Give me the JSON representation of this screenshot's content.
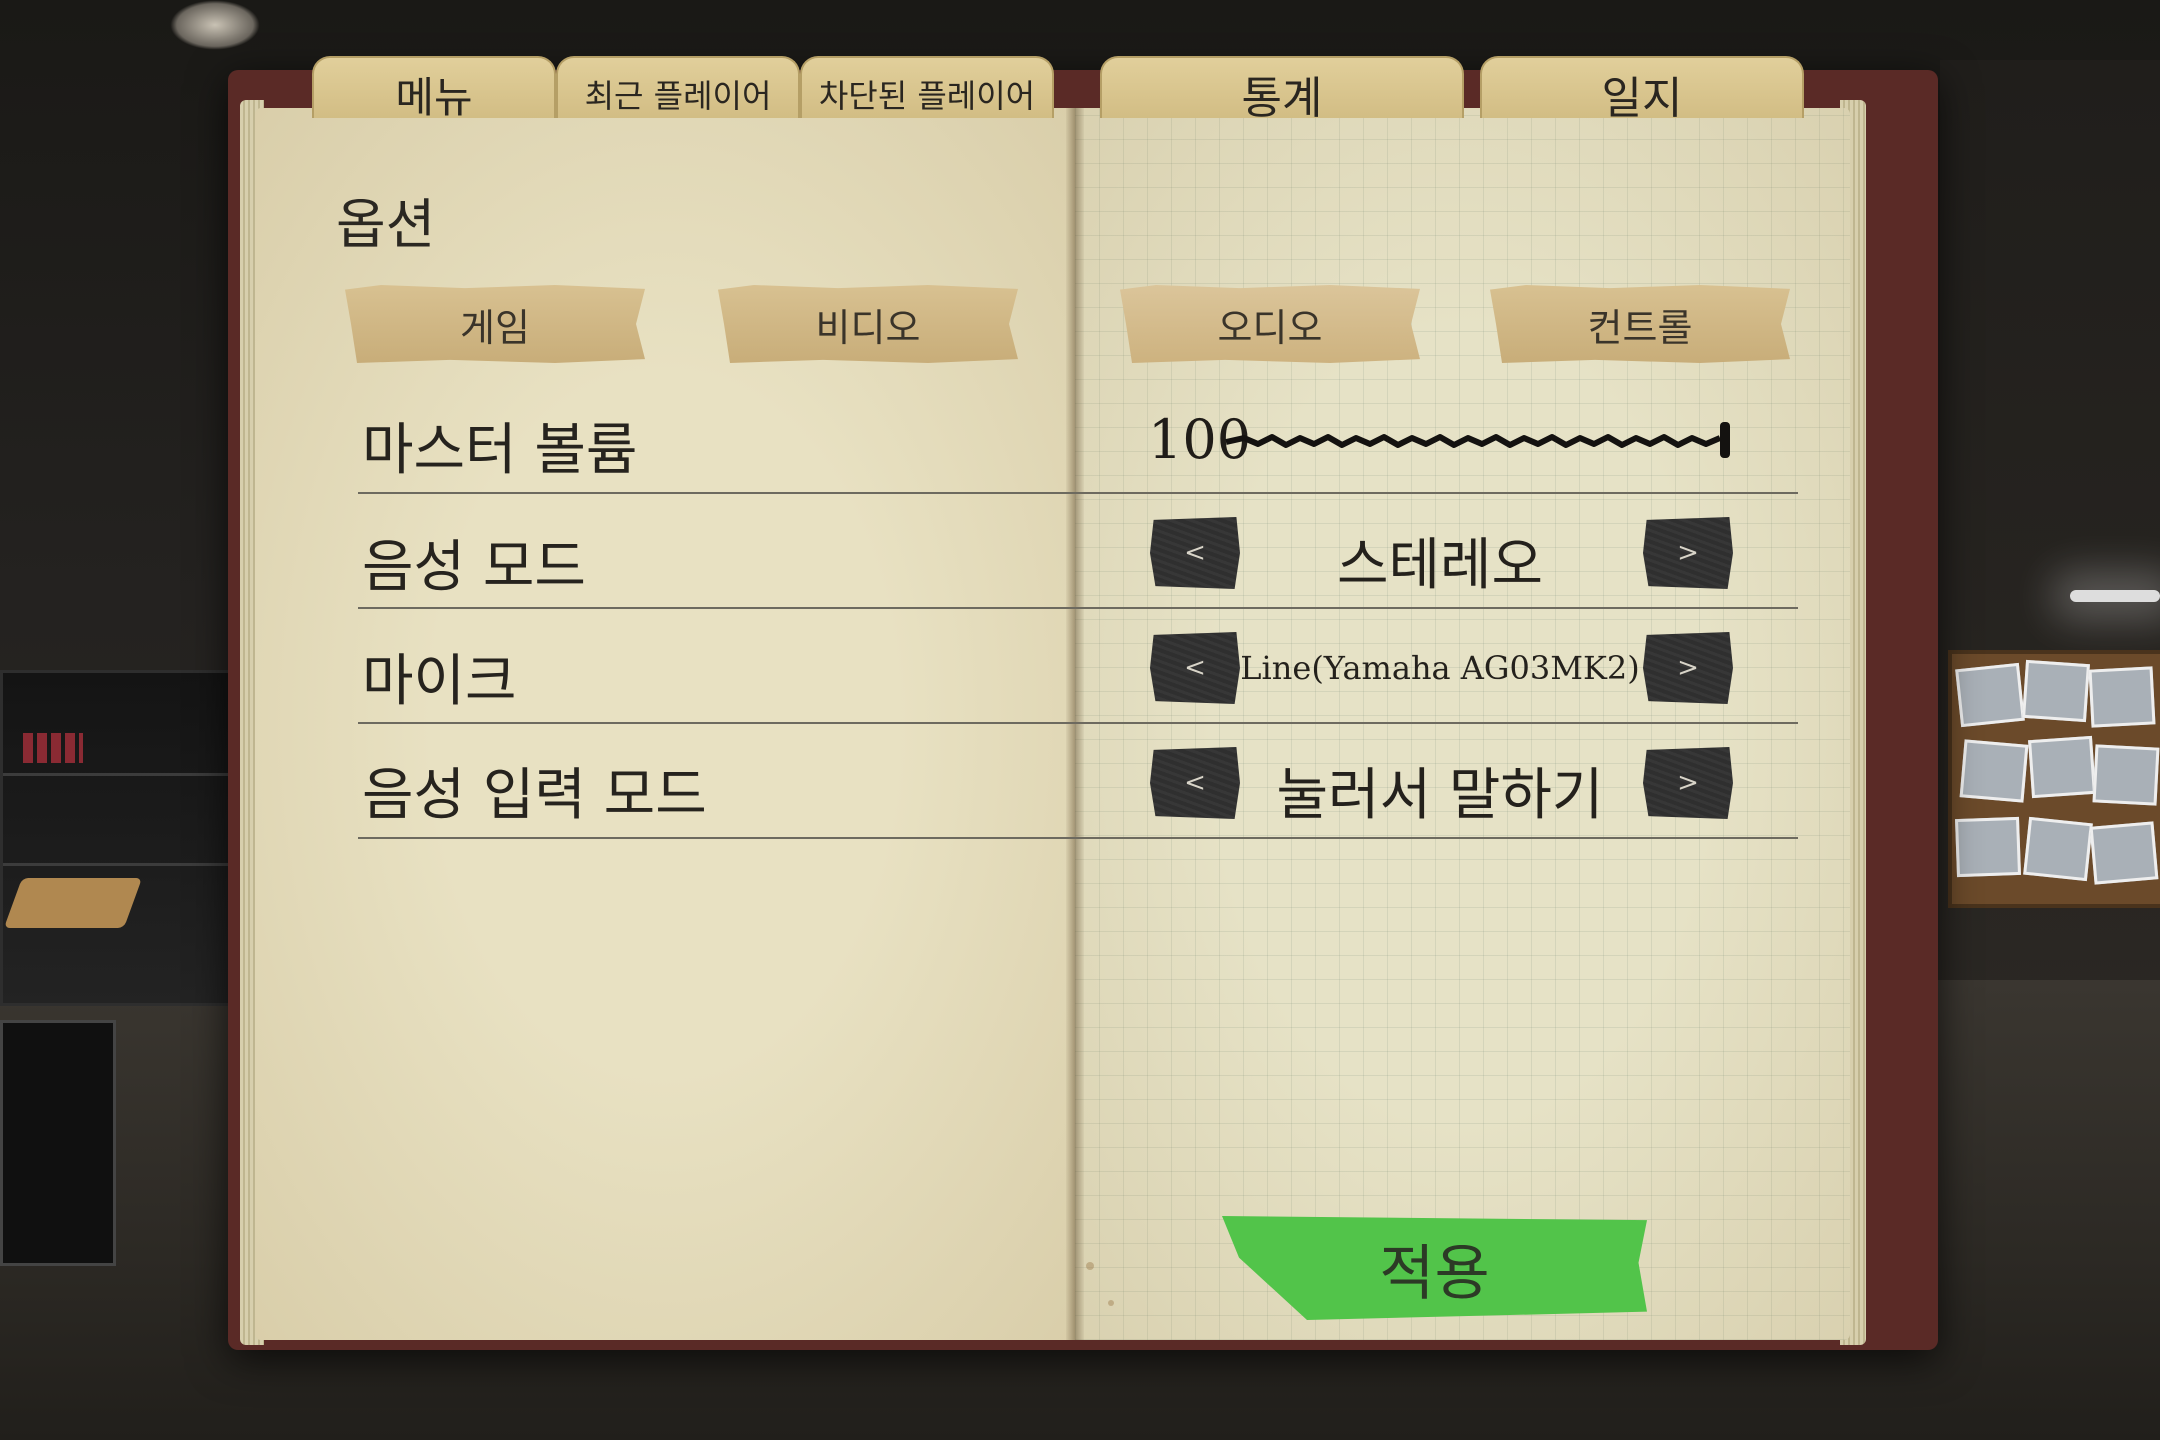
{
  "tabs": {
    "menu": "메뉴",
    "recent_players": "최근 플레이어",
    "blocked_players": "차단된 플레이어",
    "stats": "통계",
    "journal": "일지"
  },
  "options": {
    "title": "옵션",
    "subtabs": {
      "game": "게임",
      "video": "비디오",
      "audio": "오디오",
      "controls": "컨트롤"
    },
    "active_subtab": "오디오"
  },
  "settings": {
    "master_volume": {
      "label": "마스터 볼륨",
      "value": "100",
      "level": 1.0
    },
    "voice_mode": {
      "label": "음성 모드",
      "value": "스테레오"
    },
    "microphone": {
      "label": "마이크",
      "value": "Line(Yamaha AG03MK2)"
    },
    "voice_input_mode": {
      "label": "음성 입력 모드",
      "value": "눌러서 말하기"
    }
  },
  "arrows": {
    "prev": "<",
    "next": ">"
  },
  "apply_label": "적용",
  "colors": {
    "apply": "#52c44a",
    "page": "#e8e1c2",
    "arrow_button": "#2f2f2f"
  }
}
